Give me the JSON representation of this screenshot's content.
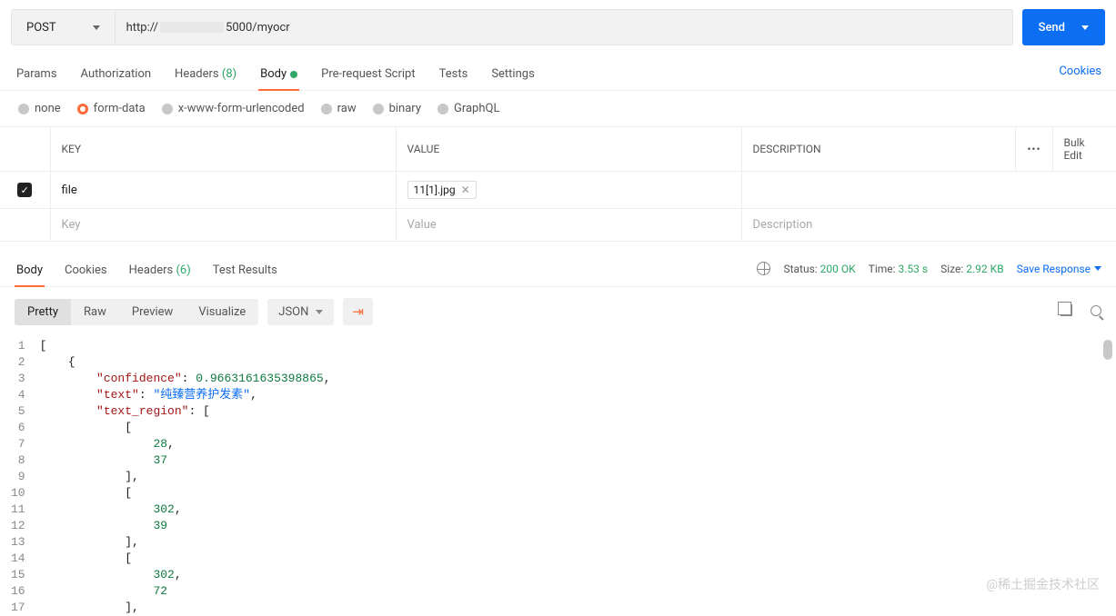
{
  "method": "POST",
  "url_prefix": "http://",
  "url_port_path": "5000/myocr",
  "send_label": "Send",
  "req_tabs": {
    "params": "Params",
    "authorization": "Authorization",
    "headers_label": "Headers",
    "headers_count": "(8)",
    "body": "Body",
    "prerequest": "Pre-request Script",
    "tests": "Tests",
    "settings": "Settings"
  },
  "cookies_link": "Cookies",
  "body_opts": {
    "none": "none",
    "formdata": "form-data",
    "urlencoded": "x-www-form-urlencoded",
    "raw": "raw",
    "binary": "binary",
    "graphql": "GraphQL"
  },
  "kv_headers": {
    "key": "KEY",
    "value": "VALUE",
    "description": "DESCRIPTION",
    "bulk": "Bulk Edit"
  },
  "kv_row": {
    "key": "file",
    "value_file": "11[1].jpg"
  },
  "kv_ph": {
    "key": "Key",
    "value": "Value",
    "description": "Description"
  },
  "resp_tabs": {
    "body": "Body",
    "cookies": "Cookies",
    "headers_label": "Headers",
    "headers_count": "(6)",
    "testresults": "Test Results"
  },
  "status": {
    "status_label": "Status:",
    "status_val": "200 OK",
    "time_label": "Time:",
    "time_val": "3.53 s",
    "size_label": "Size:",
    "size_val": "2.92 KB"
  },
  "save_response": "Save Response",
  "view_buttons": {
    "pretty": "Pretty",
    "raw": "Raw",
    "preview": "Preview",
    "visualize": "Visualize"
  },
  "format_select": "JSON",
  "code_lines": [
    "[",
    "    {",
    "        \"confidence\": 0.9663161635398865,",
    "        \"text\": \"纯臻营养护发素\",",
    "        \"text_region\": [",
    "            [",
    "                28,",
    "                37",
    "            ],",
    "            [",
    "                302,",
    "                39",
    "            ],",
    "            [",
    "                302,",
    "                72",
    "            ],"
  ],
  "watermark": "@稀土掘金技术社区"
}
